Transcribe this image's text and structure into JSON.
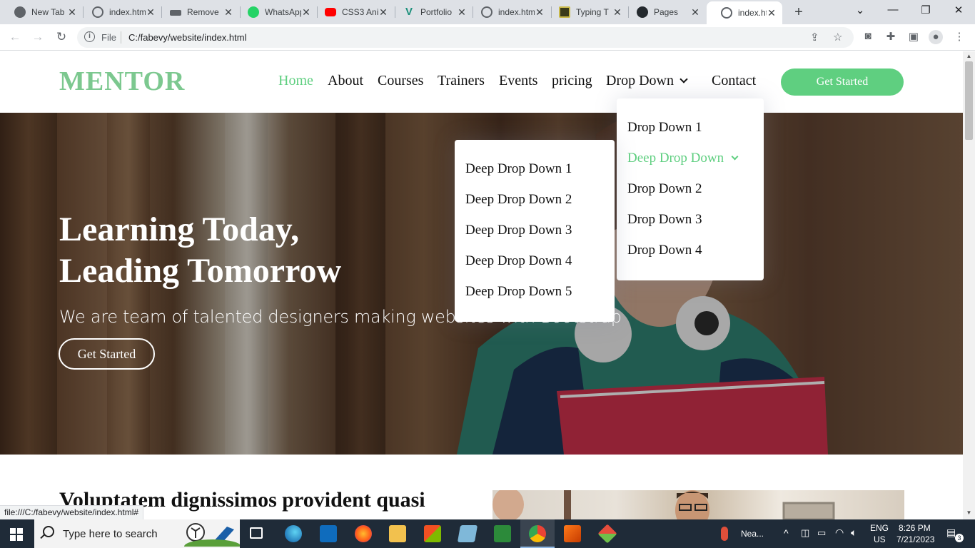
{
  "browser": {
    "tabs": [
      {
        "title": "New Tab",
        "icon": "chrome-icon"
      },
      {
        "title": "index.htm",
        "icon": "globe-icon"
      },
      {
        "title": "Remove",
        "icon": "hat-icon"
      },
      {
        "title": "WhatsApp",
        "icon": "whatsapp-icon"
      },
      {
        "title": "CSS3 Ani",
        "icon": "youtube-icon"
      },
      {
        "title": "Portfolio",
        "icon": "v-logo-icon"
      },
      {
        "title": "index.htm",
        "icon": "globe-icon"
      },
      {
        "title": "Typing T",
        "icon": "typing-icon"
      },
      {
        "title": "Pages",
        "icon": "github-icon"
      },
      {
        "title": "index.htm",
        "icon": "globe-icon"
      }
    ],
    "active_tab_index": 9,
    "new_tab_symbol": "+",
    "omnibox": {
      "scheme_label": "File",
      "url": "C:/fabevy/website/index.html"
    },
    "status_url": "file:///C:/fabevy/website/index.html#"
  },
  "site": {
    "logo": "MENTOR",
    "nav": [
      {
        "label": "Home",
        "active": true
      },
      {
        "label": "About"
      },
      {
        "label": "Courses"
      },
      {
        "label": "Trainers"
      },
      {
        "label": "Events"
      },
      {
        "label": "pricing"
      },
      {
        "label": "Drop Down",
        "has_children": true
      },
      {
        "label": "Contact"
      }
    ],
    "cta": "Get Started",
    "dropdown": {
      "items": [
        "Drop Down 1",
        "Deep Drop Down",
        "Drop Down 2",
        "Drop Down 3",
        "Drop Down 4"
      ],
      "active_item": "Deep Drop Down"
    },
    "deep_dropdown": {
      "items": [
        "Deep Drop Down 1",
        "Deep Drop Down 2",
        "Deep Drop Down 3",
        "Deep Drop Down 4",
        "Deep Drop Down 5"
      ]
    },
    "hero": {
      "title_line1": "Learning Today,",
      "title_line2": "Leading Tomorrow",
      "subtitle": "We are team of talented designers making websites with Bootstrap",
      "button": "Get Started"
    },
    "about_title": "Voluptatem dignissimos provident quasi"
  },
  "taskbar": {
    "search_placeholder": "Type here to search",
    "weather": "Nea...",
    "language_line1": "ENG",
    "language_line2": "US",
    "time": "8:26 PM",
    "date": "7/21/2023",
    "notification_count": "3"
  },
  "colors": {
    "accent": "#5fcf80",
    "logo": "#7cc88f",
    "taskbar": "#1f2b38"
  }
}
